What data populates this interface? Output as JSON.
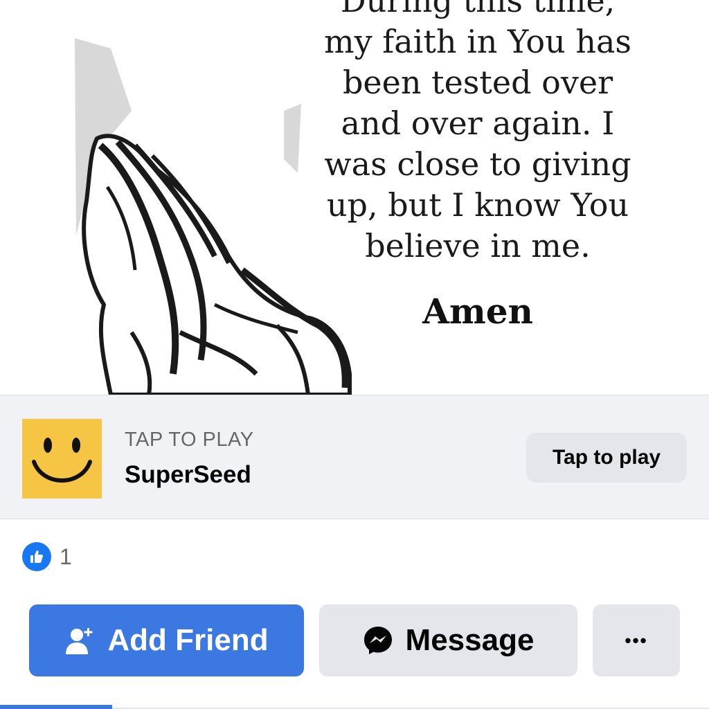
{
  "post": {
    "prayer_lines": [
      "During this time,",
      "my faith in You has",
      "been tested over",
      "and over again. I",
      "was close to giving",
      "up, but I know You",
      "believe in me."
    ],
    "closing": "Amen",
    "image_icon": "praying-hands"
  },
  "game": {
    "icon": "smiley-face",
    "icon_color": "#f7c544",
    "kicker": "TAP TO PLAY",
    "name": "SuperSeed",
    "button_label": "Tap to play"
  },
  "reactions": {
    "icon": "like-thumb",
    "count": "1"
  },
  "actions": {
    "add_friend_label": "Add Friend",
    "add_friend_icon": "add-person",
    "message_label": "Message",
    "message_icon": "messenger",
    "more_label": "•••"
  },
  "colors": {
    "primary_blue": "#3b78e2",
    "secondary_gray": "#e4e6eb",
    "bar_background": "#f0f2f5"
  }
}
